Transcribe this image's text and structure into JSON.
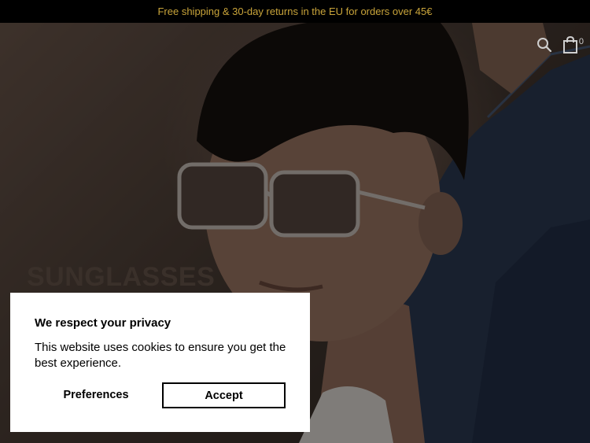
{
  "announcement": {
    "text": "Free shipping & 30-day returns in the EU for orders over 45€"
  },
  "header": {
    "search_icon": "search-icon",
    "cart_icon": "shopping-bag-icon",
    "cart_count": "0"
  },
  "hero": {
    "title": "SUNGLASSES",
    "image": "photo of a young man with dark hair wearing clear-frame sunglasses and a denim jacket"
  },
  "cookie_banner": {
    "title": "We respect your privacy",
    "body": "This website uses cookies to ensure you get the best experience.",
    "preferences_label": "Preferences",
    "accept_label": "Accept"
  },
  "colors": {
    "announcement_bg": "#000000",
    "announcement_text": "#c9a43a",
    "dialog_bg": "#ffffff",
    "dialog_text": "#000000"
  }
}
